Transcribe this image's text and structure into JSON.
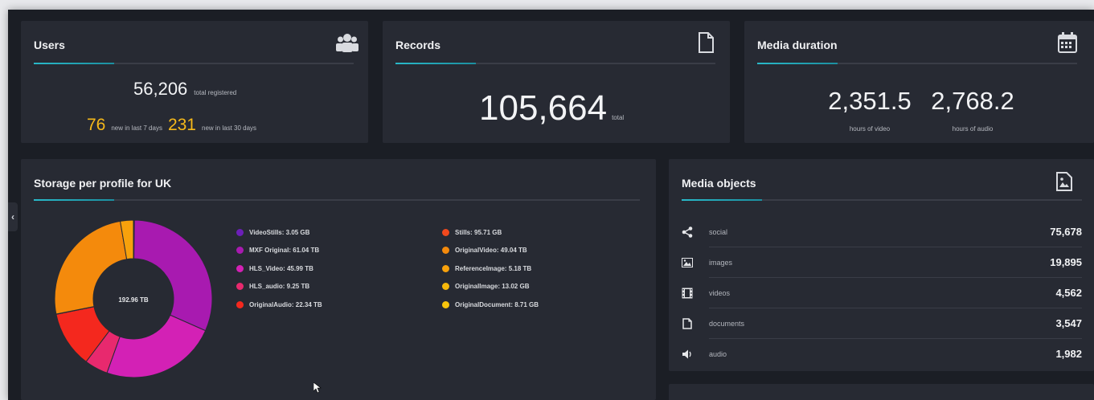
{
  "users": {
    "title": "Users",
    "total": "56,206",
    "total_label": "total registered",
    "new7": "76",
    "new7_label": "new in last 7 days",
    "new30": "231",
    "new30_label": "new in last 30 days",
    "icon": "users-icon"
  },
  "records": {
    "title": "Records",
    "total": "105,664",
    "total_label": "total",
    "icon": "document-icon"
  },
  "duration": {
    "title": "Media duration",
    "video": "2,351.5",
    "video_label": "hours of video",
    "audio": "2,768.2",
    "audio_label": "hours of audio",
    "icon": "calendar-icon"
  },
  "storage": {
    "title": "Storage per profile for UK",
    "center_label": "192.96 TB"
  },
  "chart_data": {
    "type": "pie",
    "title": "Storage per profile for UK",
    "unit": "TB",
    "center_label": "192.96 TB",
    "labels": [
      "VideoStills",
      "MXF Original",
      "HLS_Video",
      "HLS_audio",
      "OriginalAudio",
      "Stills",
      "OriginalVideo",
      "ReferenceImage",
      "OriginalImage",
      "OriginalDocument"
    ],
    "display": [
      "VideoStills: 3.05 GB",
      "MXF Original: 61.04 TB",
      "HLS_Video: 45.99 TB",
      "HLS_audio: 9.25 TB",
      "OriginalAudio: 22.34 TB",
      "Stills: 95.71 GB",
      "OriginalVideo: 49.04 TB",
      "ReferenceImage: 5.18 TB",
      "OriginalImage: 13.02 GB",
      "OriginalDocument: 8.71 GB"
    ],
    "values": [
      0.00305,
      61.04,
      45.99,
      9.25,
      22.34,
      0.09571,
      49.04,
      5.18,
      0.01302,
      0.00871
    ],
    "colors": [
      "#6c1fb8",
      "#a81ab0",
      "#d321b5",
      "#e8296e",
      "#f4281e",
      "#f1491d",
      "#f48a0c",
      "#f7a10c",
      "#f6b80b",
      "#f7c40c"
    ],
    "legend_placement": "right"
  },
  "media": {
    "title": "Media objects",
    "icon": "media-file-icon",
    "rows": [
      {
        "icon": "share-icon",
        "label": "social",
        "value": "75,678"
      },
      {
        "icon": "image-icon",
        "label": "images",
        "value": "19,895"
      },
      {
        "icon": "film-icon",
        "label": "videos",
        "value": "4,562"
      },
      {
        "icon": "document-icon",
        "label": "documents",
        "value": "3,547"
      },
      {
        "icon": "speaker-icon",
        "label": "audio",
        "value": "1,982"
      }
    ]
  },
  "colors": {
    "accent": "#29b9c9",
    "highlight": "#f6b91a",
    "background": "#1b1e25",
    "card": "#272a33"
  }
}
